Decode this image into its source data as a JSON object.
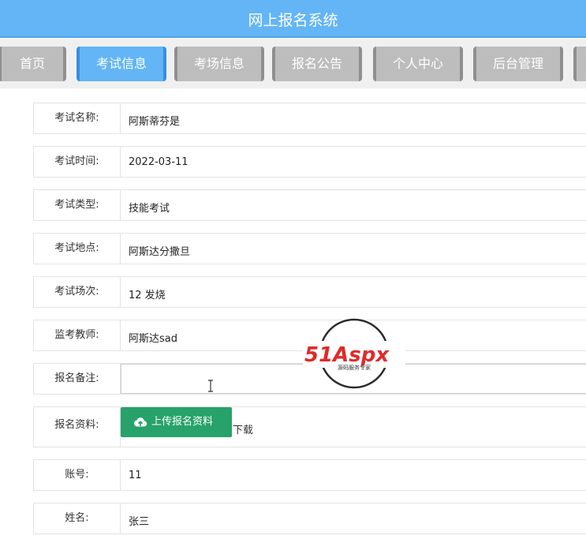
{
  "header": {
    "title": "网上报名系统"
  },
  "nav": {
    "tabs": [
      {
        "label": "首页",
        "active": false
      },
      {
        "label": "考试信息",
        "active": true
      },
      {
        "label": "考场信息",
        "active": false
      },
      {
        "label": "报名公告",
        "active": false
      },
      {
        "label": "个人中心",
        "active": false
      },
      {
        "label": "后台管理",
        "active": false
      }
    ]
  },
  "form": {
    "exam_name": {
      "label": "考试名称:",
      "value": "阿斯蒂芬是"
    },
    "exam_time": {
      "label": "考试时间:",
      "value": "2022-03-11"
    },
    "exam_type": {
      "label": "考试类型:",
      "value": "技能考试"
    },
    "exam_location": {
      "label": "考试地点:",
      "value": "阿斯达分撒旦"
    },
    "exam_session": {
      "label": "考试场次:",
      "value": "12 发烧"
    },
    "proctor": {
      "label": "监考教师:",
      "value": "阿斯达sad"
    },
    "note": {
      "label": "报名备注:",
      "value": ""
    },
    "material": {
      "label": "报名资料:",
      "upload_label": "上传报名资料",
      "download_label": "下载"
    },
    "account": {
      "label": "账号:",
      "value": "11"
    },
    "name": {
      "label": "姓名:",
      "value": "张三"
    }
  },
  "watermark": {
    "brand": "51Aspx",
    "tagline": "源码服务专家"
  },
  "colors": {
    "header": "#63b5f6",
    "tab_active": "#63b5f6",
    "tab_inactive": "#bdbdbd",
    "upload_button": "#27a26a"
  }
}
